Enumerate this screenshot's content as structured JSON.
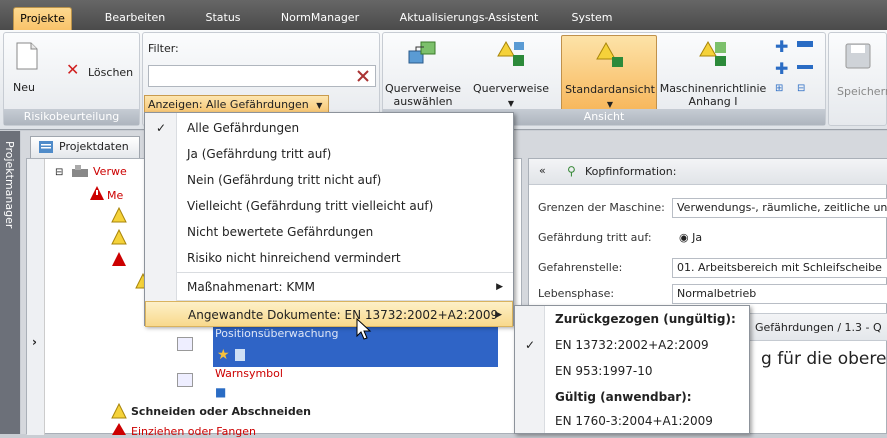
{
  "tabs": [
    {
      "label": "Projekte",
      "active": true
    },
    {
      "label": "Bearbeiten",
      "active": false
    },
    {
      "label": "Status",
      "active": false
    },
    {
      "label": "NormManager",
      "active": false
    },
    {
      "label": "Aktualisierungs-Assistent",
      "active": false
    },
    {
      "label": "System",
      "active": false
    }
  ],
  "ribbon": {
    "neu": "Neu",
    "loeschen": "Löschen",
    "group_risk": "Risikobeurteilung",
    "filter_label": "Filter:",
    "filter_value": "",
    "anzeigen": "Anzeigen: Alle Gefährdungen",
    "querverweise_auswaehlen": [
      "Querverweise",
      "auswählen"
    ],
    "querverweise": "Querverweise",
    "standardansicht": "Standardansicht",
    "maschinenrichtlinie": [
      "Maschinenrichtlinie",
      "Anhang I"
    ],
    "group_ansicht": "Ansicht",
    "speichern": "Speichern"
  },
  "sidebar_label": "Projektmanager",
  "tree": {
    "tab": "Projektdaten",
    "items": [
      "Verwe",
      "Me",
      "Positionsüberwachung",
      "Warnsymbol",
      "Schneiden oder Abschneiden",
      "Einziehen oder Fangen"
    ]
  },
  "right": {
    "header": "Kopfinformation:",
    "rows": [
      {
        "label": "Grenzen der Maschine:",
        "value": "Verwendungs-, räumliche, zeitliche und"
      },
      {
        "label": "Gefährdung tritt auf:",
        "value": "Ja"
      },
      {
        "label": "Gefahrenstelle:",
        "value": "01. Arbeitsbereich mit Schleifscheibe"
      },
      {
        "label": "Lebensphase:",
        "value": "Normalbetrieb"
      }
    ],
    "breadcrumb": "Gefährdungen / 1.3 - Q",
    "big_text": "g für die oberen"
  },
  "menu": {
    "items": [
      {
        "label": "Alle Gefährdungen",
        "checked": true
      },
      {
        "label": "Ja (Gefährdung tritt auf)"
      },
      {
        "label": "Nein (Gefährdung tritt nicht auf)"
      },
      {
        "label": "Vielleicht (Gefährdung tritt vielleicht auf)"
      },
      {
        "label": "Nicht bewertete Gefährdungen"
      },
      {
        "label": "Risiko nicht hinreichend vermindert"
      },
      {
        "label": "Maßnahmenart: KMM"
      },
      {
        "label": "Angewandte Dokumente: EN 13732:2002+A2:2009"
      }
    ]
  },
  "submenu": {
    "head1": "Zurückgezogen (ungültig):",
    "item1": "EN 13732:2002+A2:2009",
    "item2": "EN 953:1997-10",
    "head2": "Gültig (anwendbar):",
    "item3": "EN 1760-3:2004+A1:2009"
  },
  "colors": {
    "accent": "#f9c36a",
    "ribbon_dark": "#4b4b4b",
    "warn_red": "#cc0000",
    "tree_selection": "#2f64c6"
  }
}
